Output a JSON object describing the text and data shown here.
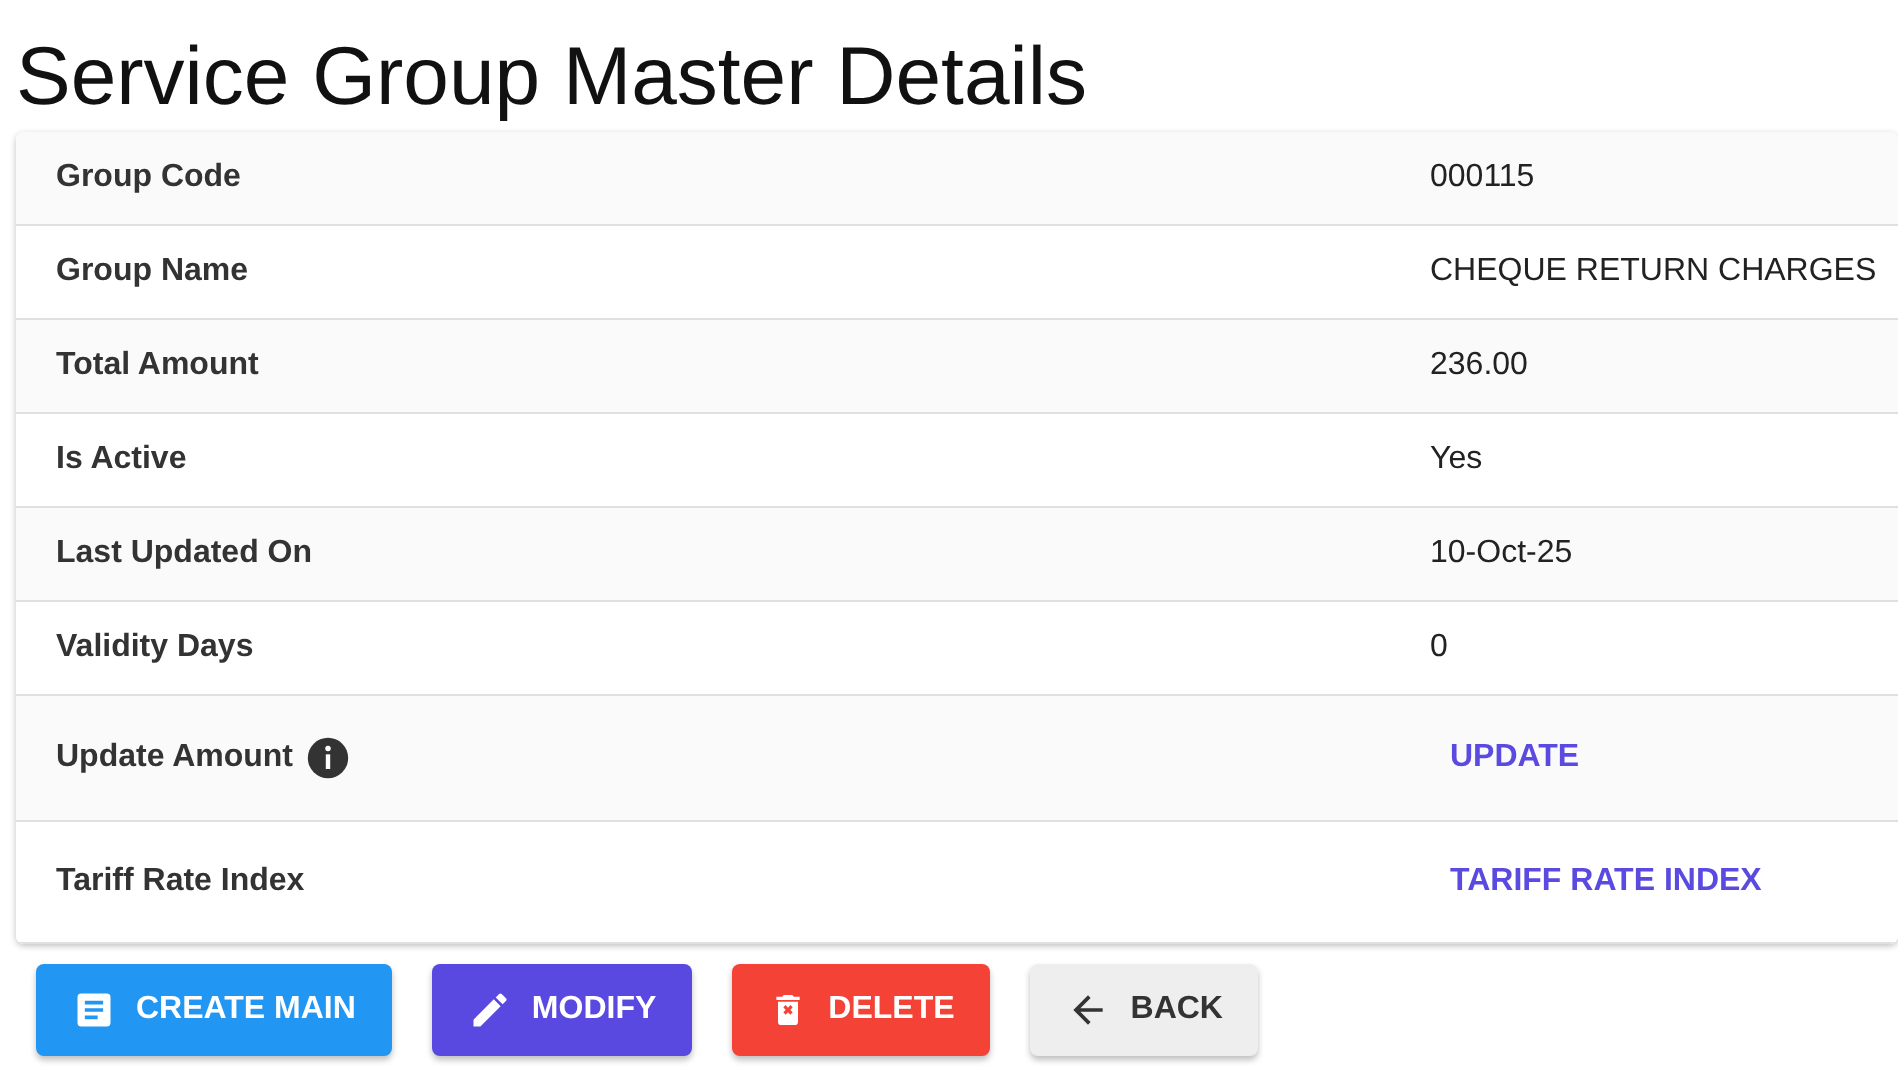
{
  "title": "Service Group Master Details",
  "rows": [
    {
      "label": "Group Code",
      "kind": "text",
      "value": "000115"
    },
    {
      "label": "Group Name",
      "kind": "text",
      "value": "CHEQUE RETURN CHARGES"
    },
    {
      "label": "Total Amount",
      "kind": "text",
      "value": "236.00"
    },
    {
      "label": "Is Active",
      "kind": "text",
      "value": "Yes"
    },
    {
      "label": "Last Updated On",
      "kind": "text",
      "value": "10-Oct-25"
    },
    {
      "label": "Validity Days",
      "kind": "text",
      "value": "0"
    },
    {
      "label": "Update Amount",
      "kind": "link",
      "info": true,
      "value": "UPDATE"
    },
    {
      "label": "Tariff Rate Index",
      "kind": "link",
      "value": "TARIFF RATE INDEX"
    }
  ],
  "buttons": [
    {
      "label": "CREATE MAIN",
      "kind": "create"
    },
    {
      "label": "MODIFY",
      "kind": "modify"
    },
    {
      "label": "DELETE",
      "kind": "delete"
    },
    {
      "label": "BACK",
      "kind": "back"
    }
  ]
}
